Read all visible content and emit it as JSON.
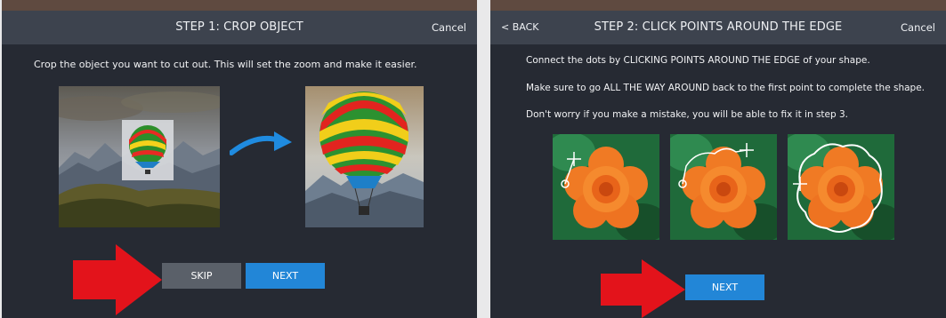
{
  "step1": {
    "title": "STEP 1: CROP OBJECT",
    "cancel_label": "Cancel",
    "instruction": "Crop the object you want to cut out. This will set the zoom and make it easier.",
    "skip_label": "SKIP",
    "next_label": "NEXT"
  },
  "step2": {
    "back_label": "< BACK",
    "title": "STEP 2: CLICK POINTS AROUND THE EDGE",
    "cancel_label": "Cancel",
    "instructions": [
      "Connect the dots by CLICKING POINTS AROUND THE EDGE of your shape.",
      "Make sure to go ALL THE WAY AROUND back to the first point to complete the shape.",
      "Don't worry if you make a mistake, you will be able to fix it in step 3."
    ],
    "next_label": "NEXT"
  },
  "colors": {
    "panel_bg": "#262a33",
    "header_bg": "#3d434e",
    "accent_blue": "#2286d7",
    "skip_gray": "#5a6069",
    "arrow_red": "#e3131b"
  }
}
